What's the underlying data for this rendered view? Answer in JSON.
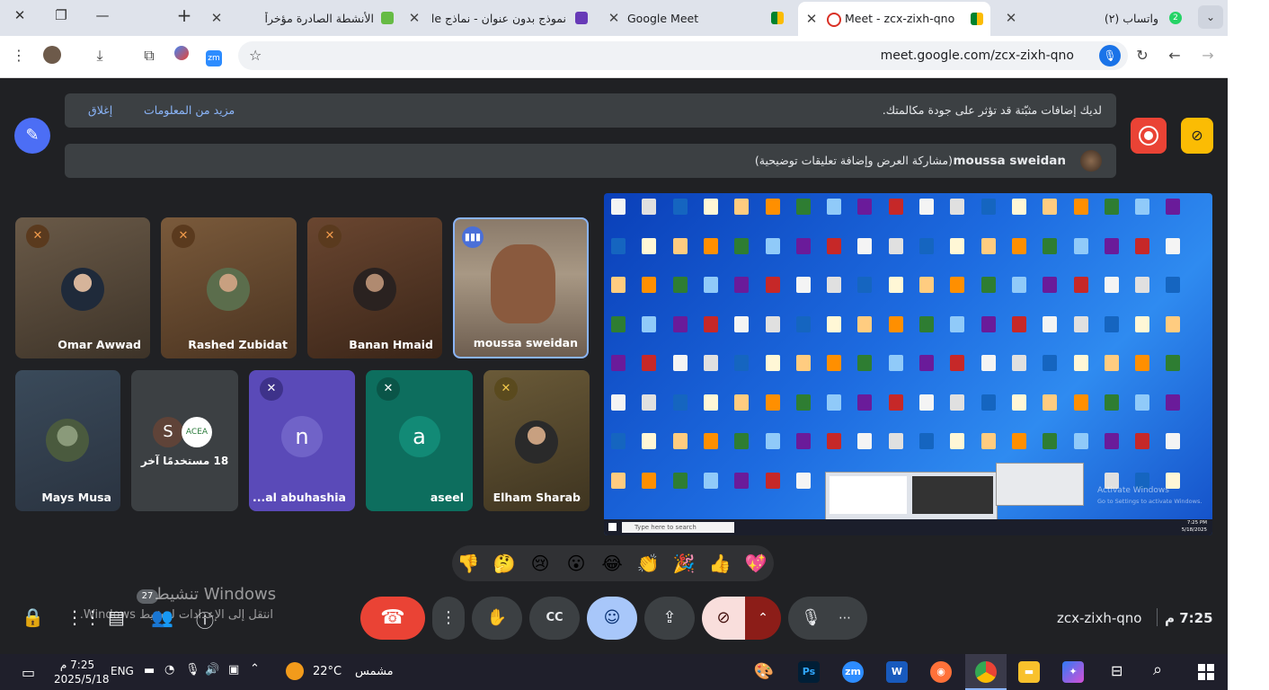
{
  "browser": {
    "tabs": [
      {
        "title": "واتساب (٢)",
        "badge": "2",
        "active": false
      },
      {
        "title": "Meet - zcx-zixh-qno",
        "active": true
      },
      {
        "title": "Google Meet",
        "active": false
      },
      {
        "title": "نموذج بدون عنوان - نماذج Google",
        "active": false
      },
      {
        "title": "الأنشطة الصادرة مؤخراً",
        "active": false
      }
    ],
    "url": "meet.google.com/zcx-zixh-qno"
  },
  "meet": {
    "notice": {
      "text": "لديك إضافات مثبّتة قد تؤثر على جودة مكالمتك.",
      "more_info": "مزيد من المعلومات",
      "close": "إغلاق"
    },
    "presenter_banner": {
      "name": "moussa sweidan",
      "text": "(مشاركة العرض وإضافة تعليقات توضيحية)"
    },
    "participants_row1": [
      {
        "name": "Omar Awwad",
        "muted": true
      },
      {
        "name": "Rashed Zubidat",
        "muted": true
      },
      {
        "name": "Banan Hmaid",
        "muted": true
      },
      {
        "name": "moussa sweidan",
        "muted": false,
        "speaking": true
      }
    ],
    "participants_row2": [
      {
        "name": "Mays Musa",
        "muted": false
      },
      {
        "name": "18 مستخدمًا آخر",
        "letter": "S"
      },
      {
        "name": "...al abuhashia",
        "letter": "n",
        "muted": true
      },
      {
        "name": "aseel",
        "letter": "a",
        "muted": true
      },
      {
        "name": "Elham Sharab",
        "muted": true
      }
    ],
    "shared_screen": {
      "taskbar_search": "Type here to search",
      "activate_title": "Activate Windows",
      "activate_sub": "Go to Settings to activate Windows.",
      "clock_time": "7:25 PM",
      "clock_date": "5/18/2025"
    },
    "reactions": [
      "💖",
      "👍",
      "🎉",
      "👏",
      "😂",
      "😮",
      "😢",
      "🤔",
      "👎"
    ],
    "meeting_code": "zcx-zixh-qno",
    "time": "7:25 م",
    "people_count": "27",
    "watermark_title": "تنشيط Windows",
    "watermark_sub": "انتقل إلى الإعدادات لتنشيط Windows."
  },
  "taskbar": {
    "weather": "مشمس",
    "temp": "22°C",
    "lang": "ENG",
    "time": "7:25 م",
    "date": "2025/5/18"
  },
  "colors": {
    "meet_bg": "#202124",
    "accent_blue": "#8ab4f8",
    "end_call": "#ea4335",
    "record_red": "#ea4335",
    "yellow": "#fbbc04"
  }
}
